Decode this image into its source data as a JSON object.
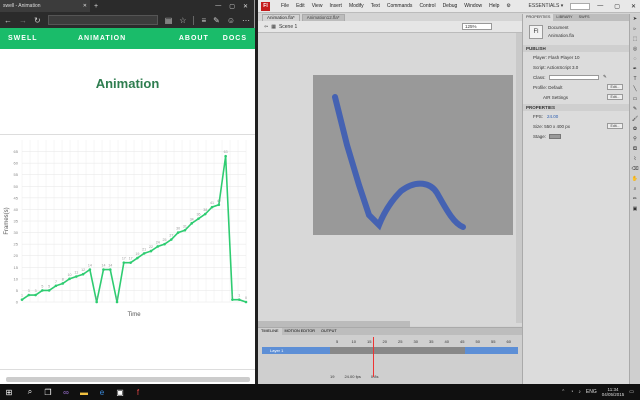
{
  "browser": {
    "tab_title": "swell - Animation",
    "tab_close": "✕",
    "new_tab": "+",
    "nav": {
      "brand": "SWELL",
      "center": "ANIMATION",
      "about": "ABOUT",
      "docs": "DOCS"
    },
    "page_title": "Animation"
  },
  "chart_data": {
    "type": "line",
    "title": "",
    "xlabel": "Time",
    "ylabel": "Frames(s)",
    "ylim": [
      0,
      70
    ],
    "yticks": [
      0,
      5,
      10,
      15,
      20,
      25,
      30,
      35,
      40,
      45,
      50,
      55,
      60,
      65
    ],
    "x": [
      1,
      2,
      3,
      4,
      5,
      6,
      7,
      8,
      9,
      10,
      11,
      12,
      13,
      14,
      15,
      16,
      17,
      18,
      19,
      20,
      21,
      22,
      23,
      24,
      25,
      26,
      27,
      28,
      29,
      30,
      31,
      32
    ],
    "values": [
      1,
      3,
      3,
      5,
      5,
      7,
      8,
      10,
      11,
      12,
      14,
      0,
      14,
      14,
      0,
      17,
      17,
      19,
      21,
      22,
      24,
      25,
      27,
      30,
      31,
      34,
      36,
      38,
      41,
      42,
      63,
      1,
      1,
      0
    ],
    "data_labels": [
      "1",
      "3",
      "3",
      "5",
      "5",
      "7",
      "8",
      "10",
      "11",
      "12",
      "14",
      "0",
      "14",
      "14",
      "0",
      "17",
      "17",
      "19",
      "21",
      "22",
      "24",
      "25",
      "27",
      "30",
      "31",
      "34",
      "36",
      "38",
      "41",
      "42",
      "63",
      "1",
      "1",
      "0"
    ],
    "grid": true,
    "line_color": "#2ecc71"
  },
  "flash": {
    "menu": [
      "File",
      "Edit",
      "View",
      "Insert",
      "Modify",
      "Text",
      "Commands",
      "Control",
      "Debug",
      "Window",
      "Help"
    ],
    "logo": "Fl",
    "workspace": "ESSENTIALS ▾",
    "doc_tabs": [
      "Animation.fla*",
      "Animation12.fla*"
    ],
    "scene": "Scene 1",
    "zoom": "125%",
    "properties": {
      "tabs": [
        "PROPERTIES",
        "LIBRARY",
        "SWFS"
      ],
      "doc_label": "Document",
      "doc_name": "Animation.fla",
      "publish": "PUBLISH",
      "player": "Player: Flash Player 10",
      "script": "Script: ActionScript 3.0",
      "class": "Class:",
      "profile": "Profile: Default",
      "air": "AIR Settings",
      "props_header": "PROPERTIES",
      "fps_label": "FPS:",
      "fps": "24.00",
      "size": "Size: 550 x 400 px",
      "stage": "Stage:",
      "edit": "Edit..."
    },
    "timeline": {
      "tabs": [
        "TIMELINE",
        "MOTION EDITOR",
        "OUTPUT"
      ],
      "layer": "Layer 1",
      "ruler": [
        "5",
        "10",
        "15",
        "20",
        "25",
        "30",
        "35",
        "40",
        "45",
        "50",
        "55",
        "60"
      ],
      "status_fps": "24.00 fps",
      "status_time": "0.8s",
      "status_frame": "19"
    }
  },
  "taskbar": {
    "lang": "ENG",
    "time": "11:34",
    "date": "04/05/2015"
  }
}
